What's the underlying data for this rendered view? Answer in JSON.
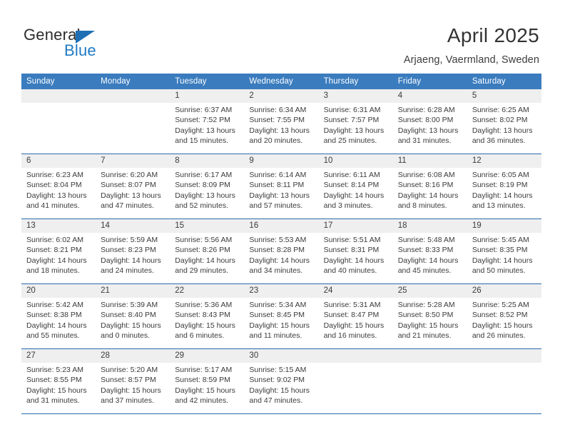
{
  "brand": {
    "name_part1": "General",
    "name_part2": "Blue",
    "triangle_color": "#1f6fb4",
    "blue_color": "#1f7ac4"
  },
  "header": {
    "title": "April 2025",
    "subtitle": "Arjaeng, Vaermland, Sweden"
  },
  "colors": {
    "header_blue": "#3a7cbe",
    "separator_blue": "#2a6aad",
    "number_band": "#efefef",
    "text": "#3b3b3b"
  },
  "weekdays": [
    "Sunday",
    "Monday",
    "Tuesday",
    "Wednesday",
    "Thursday",
    "Friday",
    "Saturday"
  ],
  "weeks": [
    {
      "numbers": [
        "",
        "",
        "1",
        "2",
        "3",
        "4",
        "5"
      ],
      "cells": [
        {
          "empty": true
        },
        {
          "empty": true
        },
        {
          "sunrise": "Sunrise: 6:37 AM",
          "sunset": "Sunset: 7:52 PM",
          "daylight1": "Daylight: 13 hours",
          "daylight2": "and 15 minutes."
        },
        {
          "sunrise": "Sunrise: 6:34 AM",
          "sunset": "Sunset: 7:55 PM",
          "daylight1": "Daylight: 13 hours",
          "daylight2": "and 20 minutes."
        },
        {
          "sunrise": "Sunrise: 6:31 AM",
          "sunset": "Sunset: 7:57 PM",
          "daylight1": "Daylight: 13 hours",
          "daylight2": "and 25 minutes."
        },
        {
          "sunrise": "Sunrise: 6:28 AM",
          "sunset": "Sunset: 8:00 PM",
          "daylight1": "Daylight: 13 hours",
          "daylight2": "and 31 minutes."
        },
        {
          "sunrise": "Sunrise: 6:25 AM",
          "sunset": "Sunset: 8:02 PM",
          "daylight1": "Daylight: 13 hours",
          "daylight2": "and 36 minutes."
        }
      ]
    },
    {
      "numbers": [
        "6",
        "7",
        "8",
        "9",
        "10",
        "11",
        "12"
      ],
      "cells": [
        {
          "sunrise": "Sunrise: 6:23 AM",
          "sunset": "Sunset: 8:04 PM",
          "daylight1": "Daylight: 13 hours",
          "daylight2": "and 41 minutes."
        },
        {
          "sunrise": "Sunrise: 6:20 AM",
          "sunset": "Sunset: 8:07 PM",
          "daylight1": "Daylight: 13 hours",
          "daylight2": "and 47 minutes."
        },
        {
          "sunrise": "Sunrise: 6:17 AM",
          "sunset": "Sunset: 8:09 PM",
          "daylight1": "Daylight: 13 hours",
          "daylight2": "and 52 minutes."
        },
        {
          "sunrise": "Sunrise: 6:14 AM",
          "sunset": "Sunset: 8:11 PM",
          "daylight1": "Daylight: 13 hours",
          "daylight2": "and 57 minutes."
        },
        {
          "sunrise": "Sunrise: 6:11 AM",
          "sunset": "Sunset: 8:14 PM",
          "daylight1": "Daylight: 14 hours",
          "daylight2": "and 3 minutes."
        },
        {
          "sunrise": "Sunrise: 6:08 AM",
          "sunset": "Sunset: 8:16 PM",
          "daylight1": "Daylight: 14 hours",
          "daylight2": "and 8 minutes."
        },
        {
          "sunrise": "Sunrise: 6:05 AM",
          "sunset": "Sunset: 8:19 PM",
          "daylight1": "Daylight: 14 hours",
          "daylight2": "and 13 minutes."
        }
      ]
    },
    {
      "numbers": [
        "13",
        "14",
        "15",
        "16",
        "17",
        "18",
        "19"
      ],
      "cells": [
        {
          "sunrise": "Sunrise: 6:02 AM",
          "sunset": "Sunset: 8:21 PM",
          "daylight1": "Daylight: 14 hours",
          "daylight2": "and 18 minutes."
        },
        {
          "sunrise": "Sunrise: 5:59 AM",
          "sunset": "Sunset: 8:23 PM",
          "daylight1": "Daylight: 14 hours",
          "daylight2": "and 24 minutes."
        },
        {
          "sunrise": "Sunrise: 5:56 AM",
          "sunset": "Sunset: 8:26 PM",
          "daylight1": "Daylight: 14 hours",
          "daylight2": "and 29 minutes."
        },
        {
          "sunrise": "Sunrise: 5:53 AM",
          "sunset": "Sunset: 8:28 PM",
          "daylight1": "Daylight: 14 hours",
          "daylight2": "and 34 minutes."
        },
        {
          "sunrise": "Sunrise: 5:51 AM",
          "sunset": "Sunset: 8:31 PM",
          "daylight1": "Daylight: 14 hours",
          "daylight2": "and 40 minutes."
        },
        {
          "sunrise": "Sunrise: 5:48 AM",
          "sunset": "Sunset: 8:33 PM",
          "daylight1": "Daylight: 14 hours",
          "daylight2": "and 45 minutes."
        },
        {
          "sunrise": "Sunrise: 5:45 AM",
          "sunset": "Sunset: 8:35 PM",
          "daylight1": "Daylight: 14 hours",
          "daylight2": "and 50 minutes."
        }
      ]
    },
    {
      "numbers": [
        "20",
        "21",
        "22",
        "23",
        "24",
        "25",
        "26"
      ],
      "cells": [
        {
          "sunrise": "Sunrise: 5:42 AM",
          "sunset": "Sunset: 8:38 PM",
          "daylight1": "Daylight: 14 hours",
          "daylight2": "and 55 minutes."
        },
        {
          "sunrise": "Sunrise: 5:39 AM",
          "sunset": "Sunset: 8:40 PM",
          "daylight1": "Daylight: 15 hours",
          "daylight2": "and 0 minutes."
        },
        {
          "sunrise": "Sunrise: 5:36 AM",
          "sunset": "Sunset: 8:43 PM",
          "daylight1": "Daylight: 15 hours",
          "daylight2": "and 6 minutes."
        },
        {
          "sunrise": "Sunrise: 5:34 AM",
          "sunset": "Sunset: 8:45 PM",
          "daylight1": "Daylight: 15 hours",
          "daylight2": "and 11 minutes."
        },
        {
          "sunrise": "Sunrise: 5:31 AM",
          "sunset": "Sunset: 8:47 PM",
          "daylight1": "Daylight: 15 hours",
          "daylight2": "and 16 minutes."
        },
        {
          "sunrise": "Sunrise: 5:28 AM",
          "sunset": "Sunset: 8:50 PM",
          "daylight1": "Daylight: 15 hours",
          "daylight2": "and 21 minutes."
        },
        {
          "sunrise": "Sunrise: 5:25 AM",
          "sunset": "Sunset: 8:52 PM",
          "daylight1": "Daylight: 15 hours",
          "daylight2": "and 26 minutes."
        }
      ]
    },
    {
      "numbers": [
        "27",
        "28",
        "29",
        "30",
        "",
        "",
        ""
      ],
      "cells": [
        {
          "sunrise": "Sunrise: 5:23 AM",
          "sunset": "Sunset: 8:55 PM",
          "daylight1": "Daylight: 15 hours",
          "daylight2": "and 31 minutes."
        },
        {
          "sunrise": "Sunrise: 5:20 AM",
          "sunset": "Sunset: 8:57 PM",
          "daylight1": "Daylight: 15 hours",
          "daylight2": "and 37 minutes."
        },
        {
          "sunrise": "Sunrise: 5:17 AM",
          "sunset": "Sunset: 8:59 PM",
          "daylight1": "Daylight: 15 hours",
          "daylight2": "and 42 minutes."
        },
        {
          "sunrise": "Sunrise: 5:15 AM",
          "sunset": "Sunset: 9:02 PM",
          "daylight1": "Daylight: 15 hours",
          "daylight2": "and 47 minutes."
        },
        {
          "empty": true
        },
        {
          "empty": true
        },
        {
          "empty": true
        }
      ]
    }
  ]
}
